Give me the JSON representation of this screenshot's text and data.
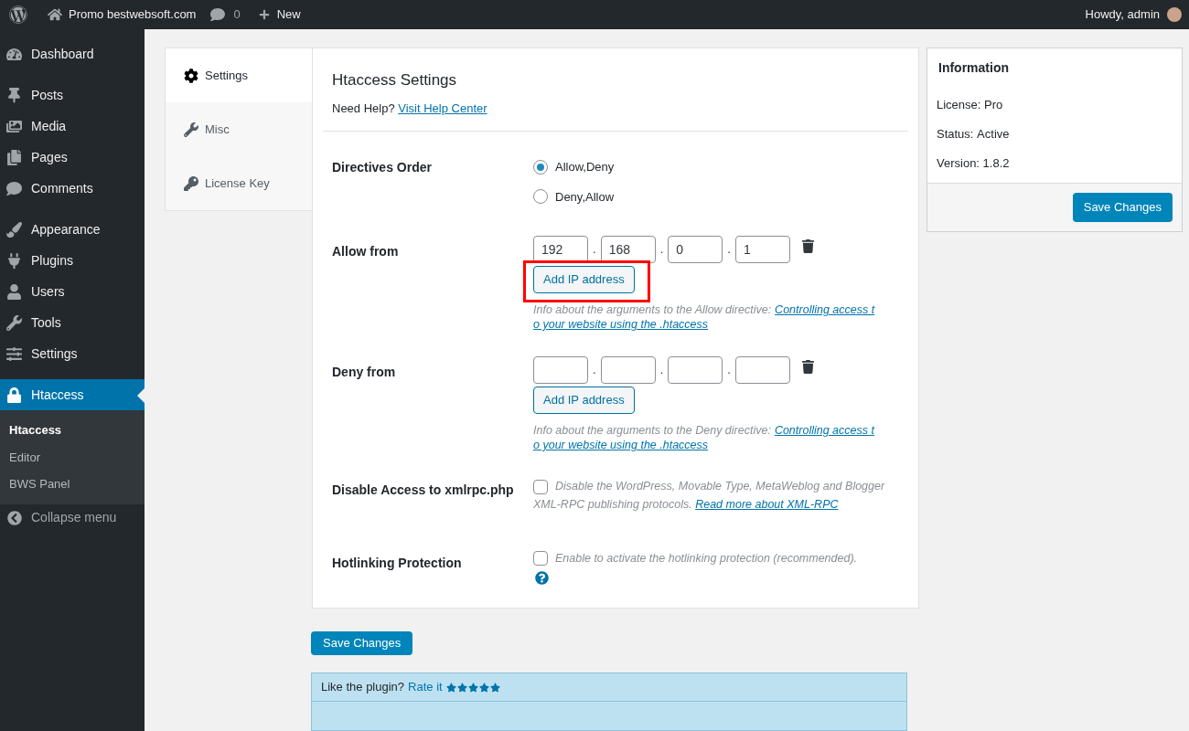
{
  "admin_bar": {
    "site": "Promo bestwebsoft.com",
    "comments": "0",
    "new": "New",
    "greeting": "Howdy, admin"
  },
  "sidebar": {
    "groups": [
      {
        "items": [
          {
            "label": "Dashboard",
            "selected": false
          }
        ]
      },
      {
        "items": [
          {
            "label": "Posts",
            "selected": false
          },
          {
            "label": "Media",
            "selected": false
          },
          {
            "label": "Pages",
            "selected": false
          },
          {
            "label": "Comments",
            "selected": false
          }
        ]
      },
      {
        "items": [
          {
            "label": "Appearance",
            "selected": false
          },
          {
            "label": "Plugins",
            "selected": false
          },
          {
            "label": "Users",
            "selected": false
          },
          {
            "label": "Tools",
            "selected": false
          },
          {
            "label": "Settings",
            "selected": false
          }
        ]
      },
      {
        "items": [
          {
            "label": "Htaccess",
            "selected": true,
            "children": [
              {
                "label": "Htaccess",
                "selected": true
              },
              {
                "label": "Editor",
                "selected": false
              },
              {
                "label": "BWS Panel",
                "selected": false
              }
            ]
          }
        ]
      }
    ],
    "collapse": "Collapse menu"
  },
  "tabs": [
    {
      "label": "Settings",
      "selected": true
    },
    {
      "label": "Misc",
      "selected": false
    },
    {
      "label": "License Key",
      "selected": false
    }
  ],
  "settings": {
    "title": "Htaccess Settings",
    "help_text": "Need Help?",
    "help_link": "Visit Help Center",
    "directives_order": {
      "label": "Directives Order",
      "options": [
        {
          "label": "Allow,Deny",
          "selected": true
        },
        {
          "label": "Deny,Allow",
          "selected": false
        }
      ]
    },
    "allow_from": {
      "label": "Allow from",
      "ip": [
        {
          "kind": "octet",
          "value": "192"
        },
        {
          "kind": "octet",
          "separator": ".",
          "value": "168"
        },
        {
          "kind": "octet",
          "separator": ".",
          "value": "0"
        },
        {
          "kind": "octet",
          "separator": ".",
          "value": "1"
        }
      ],
      "button": "Add IP address",
      "highlighted": true,
      "info": "Info about the arguments to the Allow directive:",
      "link_lines": [
        "Controlling access t",
        "o your website using the .htaccess"
      ]
    },
    "deny_from": {
      "label": "Deny from",
      "ip": [
        {
          "kind": "octet"
        },
        {
          "kind": "octet",
          "separator": "."
        },
        {
          "kind": "octet",
          "separator": "."
        },
        {
          "kind": "octet",
          "separator": "."
        }
      ],
      "button": "Add IP address",
      "highlighted": false,
      "info": "Info about the arguments to the Deny directive:",
      "link_lines": [
        "Controlling access t",
        "o your website using the .htaccess"
      ]
    },
    "xmlrpc": {
      "label": "Disable Access to xmlrpc.php",
      "checked": false,
      "text": "Disable the WordPress, Movable Type, MetaWeblog and Blogger XML-RPC publishing protocols.",
      "link": "Read more about XML-RPC"
    },
    "hotlinking": {
      "label": "Hotlinking Protection",
      "checked": false,
      "text": "Enable to activate the hotlinking protection (recommended)."
    },
    "save": "Save Changes"
  },
  "information": {
    "title": "Information",
    "rows": [
      {
        "label": "License:",
        "value": "Pro"
      },
      {
        "label": "Status:",
        "value": "Active"
      },
      {
        "label": "Version:",
        "value": "1.8.2"
      }
    ],
    "save": "Save Changes"
  },
  "rate": {
    "text": "Like the plugin?",
    "link": "Rate it",
    "stars": 5
  }
}
